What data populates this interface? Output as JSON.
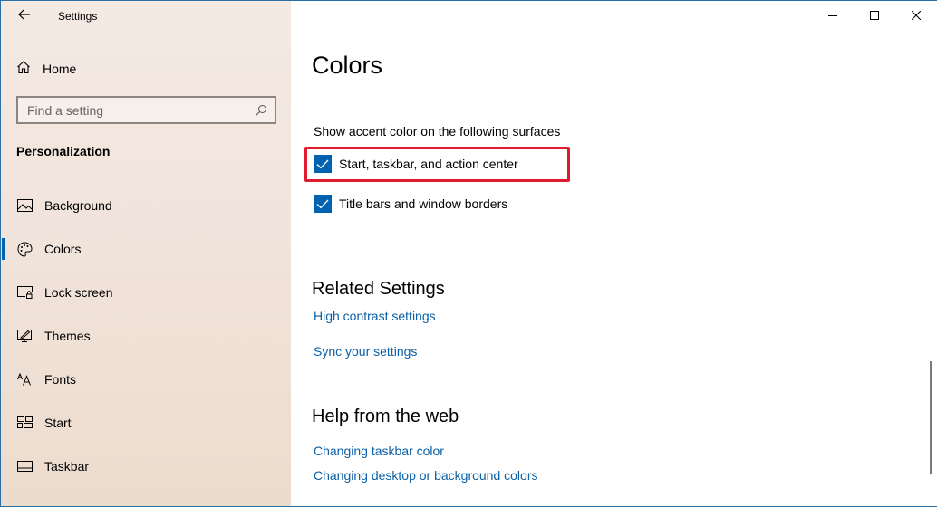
{
  "window": {
    "app_title": "Settings",
    "controls": {
      "minimize_icon": "minimize-icon",
      "maximize_icon": "maximize-icon",
      "close_icon": "close-icon"
    }
  },
  "sidebar": {
    "back_icon": "arrow-left-icon",
    "home": {
      "label": "Home",
      "icon": "home-icon"
    },
    "search": {
      "placeholder": "Find a setting",
      "value": "",
      "icon": "search-icon"
    },
    "section_title": "Personalization",
    "items": [
      {
        "label": "Background",
        "icon": "picture-icon",
        "active": false
      },
      {
        "label": "Colors",
        "icon": "palette-icon",
        "active": true
      },
      {
        "label": "Lock screen",
        "icon": "lock-screen-icon",
        "active": false
      },
      {
        "label": "Themes",
        "icon": "themes-icon",
        "active": false
      },
      {
        "label": "Fonts",
        "icon": "fonts-icon",
        "active": false
      },
      {
        "label": "Start",
        "icon": "start-icon",
        "active": false
      },
      {
        "label": "Taskbar",
        "icon": "taskbar-icon",
        "active": false
      }
    ],
    "accent_color": "#0063b1"
  },
  "main": {
    "title": "Colors",
    "surfaces_label": "Show accent color on the following surfaces",
    "checkboxes": [
      {
        "label": "Start, taskbar, and action center",
        "checked": true,
        "highlighted": true
      },
      {
        "label": "Title bars and window borders",
        "checked": true,
        "highlighted": false
      }
    ],
    "related_settings": {
      "heading": "Related Settings",
      "links": [
        "High contrast settings",
        "Sync your settings"
      ]
    },
    "help": {
      "heading": "Help from the web",
      "links": [
        "Changing taskbar color",
        "Changing desktop or background colors"
      ]
    },
    "colors": {
      "checkbox": "#0063b1",
      "link": "#0a5fa6",
      "highlight": "#e11b2e"
    }
  }
}
